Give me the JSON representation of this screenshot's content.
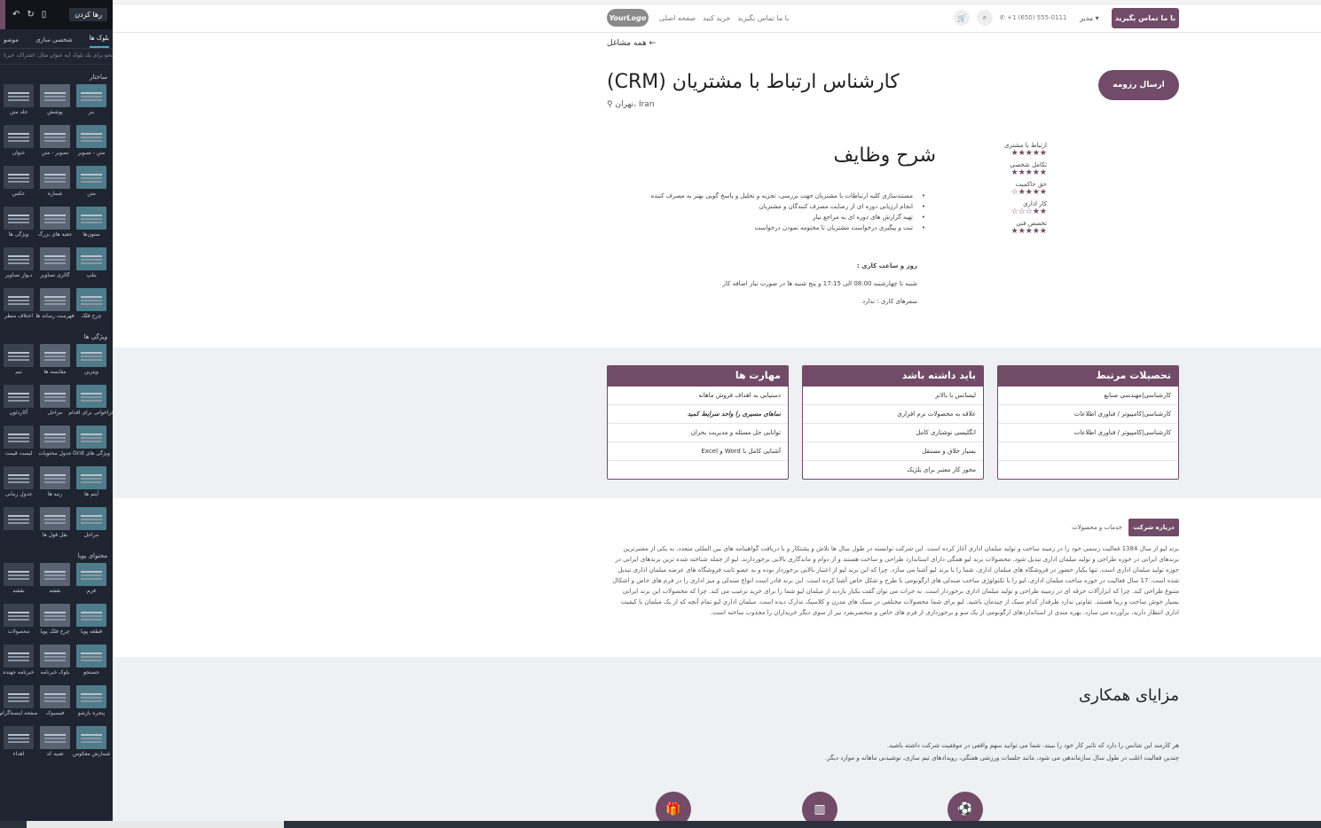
{
  "sidebar": {
    "discard_label": "رها کردن",
    "tabs": [
      "بلوک ها",
      "شخصی سازی",
      "موضو"
    ],
    "search_placeholder": "جستجو برای یک بلوک (به عنوان مثال: اشتراک، خبرنا",
    "sections": {
      "structure": "ساختار",
      "features": "ویژگی ها",
      "dynamic": "محتوای پویا"
    },
    "structure_tiles": [
      "بنر",
      "پوشش",
      "جلد متن",
      "متن - تصویر",
      "تصویر - متن",
      "عنوان",
      "متن",
      "شماره",
      "عکس",
      "ستون‌ها",
      "جعبه های بزرگ",
      "ویژگی ها",
      "بنلپ",
      "گالری تصاویر",
      "دیوار تصاویر",
      "چرخ فلک",
      "فهرست رسانه ها",
      "اختلاف منظر"
    ],
    "feature_tiles": [
      "ویترین",
      "مقایسه ها",
      "تیم",
      "فراخوانی برای اقدام",
      "مراحل",
      "آکاردئون",
      "ویژگی های Grid",
      "جدول محتویات",
      "لیست قیمت",
      "آیتم ها",
      "رتبه ها",
      "جدول زمانی",
      "مراحل",
      "نقل قول ها",
      ""
    ],
    "dynamic_tiles": [
      "فرم",
      "نقشه",
      "نقشه",
      "قطعه پویا",
      "چرخ فلک پویا",
      "محصولات",
      "جستجو",
      "بلوک خبرنامه",
      "خبرنامه جهنده",
      "پنجره بازشو",
      "فیسبوک",
      "صفحه اینستاگرام",
      "شمارش معکوس",
      "تعبیه کد",
      "اهداء"
    ]
  },
  "navbar": {
    "contact_button": "با ما تماس بگیرید",
    "admin": "مدیر",
    "phone": "+1 (650) 555-0111",
    "links": [
      "صفحه اصلی",
      "خرید کنید",
      "با ما تماس بگیرید"
    ],
    "logo_text": "YourLogo"
  },
  "job": {
    "back_link": "همه مشاغل ←",
    "title": "کارشناس ارتباط با مشتریان (CRM)",
    "location": "تهران، Iran",
    "send_resume": "ارسال رزومه",
    "duties_title": "شرح وظایف",
    "duties": [
      "مستندسازی کلیه ارتباطات با مشتریان جهت بررسی، تجزیه و تحلیل و پاسخ گویی بهتر به مصرف کننده",
      "انجام ارزیابی دوره ای از رضایت مصرف کنندگان و مشتریان",
      "تهیه گزارش های دوره ای به مراجع نیاز",
      "ثبت و پیگیری درخواست مشتریان تا مختومه نمودن درخواست"
    ],
    "work_hours_label": "روز و ساعت کاری :",
    "work_hours": "شنبه تا چهارشنبه 08:00 الی 17:15 و پنج شنبه ها در صورت نیاز اضافه کار",
    "trips": "سفرهای کاری :  ندارد"
  },
  "ratings": [
    {
      "label": "ارتباط با مشتری",
      "stars": "★★★★★"
    },
    {
      "label": "تکامل شخصی",
      "stars": "★★★★★"
    },
    {
      "label": "حق حاکمیت",
      "stars": "★★★★☆"
    },
    {
      "label": "کار اداری",
      "stars": "★★☆☆☆"
    },
    {
      "label": "تخصص فنی",
      "stars": "★★★★★"
    }
  ],
  "cards": {
    "education": {
      "title": "تحصیلات مرتبط",
      "rows": [
        "کارشناسی|مهندسی صنایع",
        "کارشناسی|کامپیوتر / فناوری اطلاعات",
        "کارشناسی|کامپیوتر / فناوری اطلاعات",
        "",
        ""
      ]
    },
    "must_have": {
      "title": "باید داشته باشد",
      "rows": [
        "لیسانس یا بالاتر",
        "علاقه به محصولات نرم افزاری",
        "انگلیسی نوشتاری کامل",
        "بسیار خلاق و مستقل",
        "مجوز کار معتبر برای بلژیک"
      ]
    },
    "skills": {
      "title": "مهارت ها",
      "rows": [
        "دستیابی به اهداف فروش ماهانه",
        "نماهای مسیری را واحد سرایط کمید",
        "توانایی حل مسئله و مدیریت بحران",
        "آشنایی کامل با Word و Excel",
        ""
      ]
    }
  },
  "about": {
    "tab_active": "درباره شرکت",
    "tab_other": "خدمات و محصولات",
    "text": "برند لیو از سال 1384 فعالیت رسمی خود را در زمینه ساخت و تولید مبلمان اداری آغاز کرده است. این شرکت توانسته در طول سال ها تلاش و پشتکار و با دریافت گواهینامه های بین المللی متعدد، به یکی از معتبرترین برندهای ایرانی در حوزه طراحی و تولید مبلمان اداری تبدیل شود. محصولات برند لیو همگی دارای استاندارد طراحی و ساخت هستند و از دوام و ماندگاری بالایی برخوردارند. لیو از جمله شناخته شده ترین برندهای ایرانی در حوزه تولید مبلمان اداری است. تنها یکبار حضور در فروشگاه های مبلمان اداری، شما را با برند لیو آشنا می سازد. چرا که این برند لیو از اعتبار بالایی برخوردار بوده و به عضو ثابت فروشگاه های عرضه مبلمان اداری تبدیل شده است. 17 سال فعالیت در حوزه ساخت مبلمان اداری، لیو را با تکنولوژی ساخت صندلی های ارگونومی با طرح و شکل خاص آشنا کرده است. این برند قادر است انواع صندلی و میز اداری را در فرم های خاص و اشکال متنوع طراحی کند. چرا که ابزارآلات حرفه ای در زمینه طراحی و تولید مبلمان اداری برخوردار است. به جرات می توان گفت یکبار بازدید از مبلمان لیو شما را برای خرید ترغیب می کند. چرا که محصولات این برند ایرانی بسیار خوش ساخت و زیبا هستند. تفاوتی ندارد طرفدار کدام سبک از چیدمان باشید. لیو برای شما محصولات مختلفی در سبک های مدرن و کلاسیک تدارک دیده است. مبلمان اداری لیو تمام آنچه که از یک مبلمان با کیفیت اداری انتظار دارید، برآورده می سازد. بهره مندی از استانداردهای ارگونومی از یک سو و برخورداری از فرم های خاص و متحصربفرد نیز از سوی دیگر خریداران را مجذوب ساخته است."
  },
  "benefits": {
    "title": "مزایای همکاری",
    "lines": [
      "هر کارمند این شانس را دارد که تاثیر کار خود را ببیند. شما می توانید سهم واقعی در موفقیت شرکت داشته باشید.",
      "چندین فعالیت اغلب در طول سال سازماندهی می شود، مانند جلسات ورزشی هفتگی، رویدادهای تیم سازی، نوشیدنی ماهانه و موارد دیگر."
    ]
  },
  "colors": {
    "brand": "#714b67",
    "sidebar": "#1e2430"
  }
}
